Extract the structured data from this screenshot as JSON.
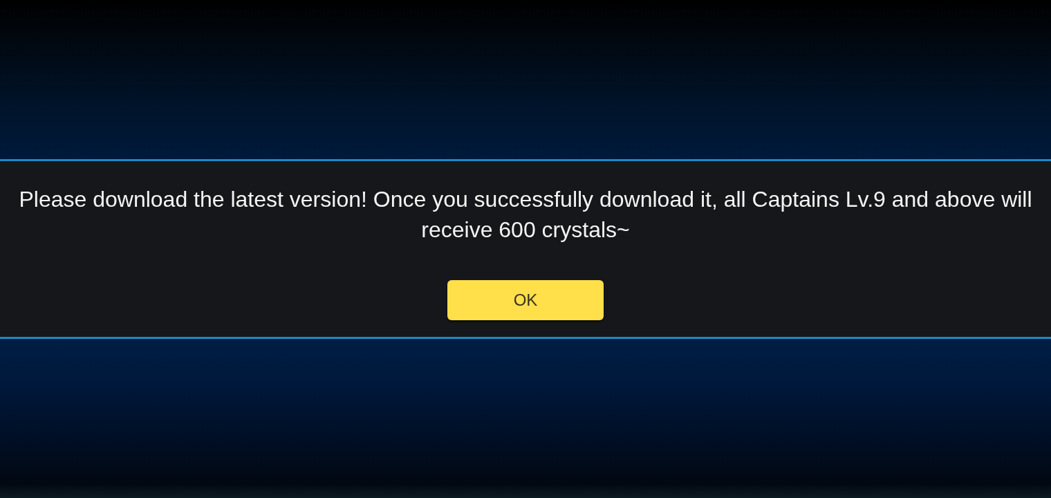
{
  "dialog": {
    "message": "Please download the latest version! Once you successfully download it, all Captains Lv.9 and above will receive 600 crystals~",
    "button": "OK"
  }
}
